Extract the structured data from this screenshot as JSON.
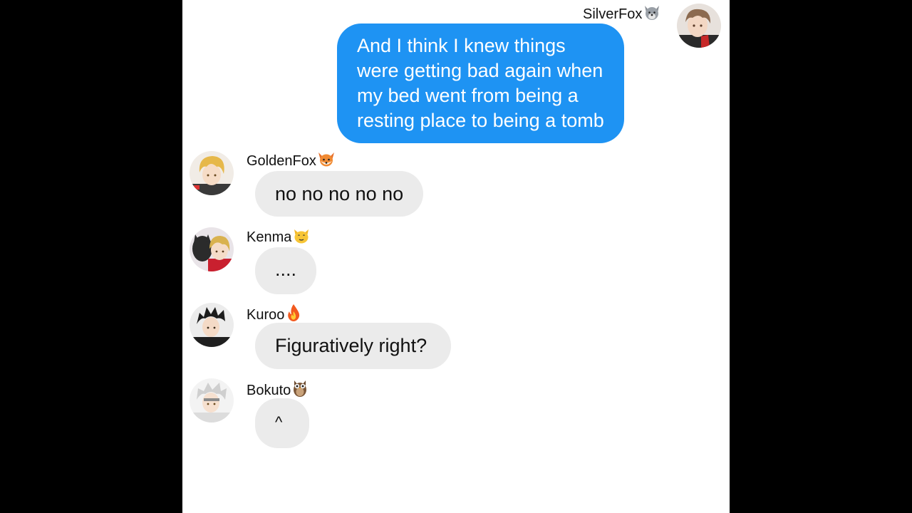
{
  "messages": [
    {
      "sender": "SilverFox",
      "emoji_icon": "wolf-icon",
      "direction": "outgoing",
      "lines": [
        "And I think I knew things",
        "were getting bad again when",
        "my bed went from being a",
        "resting place to being a tomb"
      ]
    },
    {
      "sender": "GoldenFox",
      "emoji_icon": "fox-icon",
      "direction": "incoming",
      "text": "no no no no no"
    },
    {
      "sender": "Kenma",
      "emoji_icon": "cat-icon",
      "direction": "incoming",
      "text": "...."
    },
    {
      "sender": "Kuroo",
      "emoji_icon": "fire-icon",
      "direction": "incoming",
      "text": "Figuratively right?"
    },
    {
      "sender": "Bokuto",
      "emoji_icon": "owl-icon",
      "direction": "incoming",
      "text": "^"
    }
  ],
  "colors": {
    "outgoing_bubble": "#1e93f3",
    "incoming_bubble": "#ebebeb",
    "background": "#ffffff",
    "letterbox": "#000000"
  }
}
